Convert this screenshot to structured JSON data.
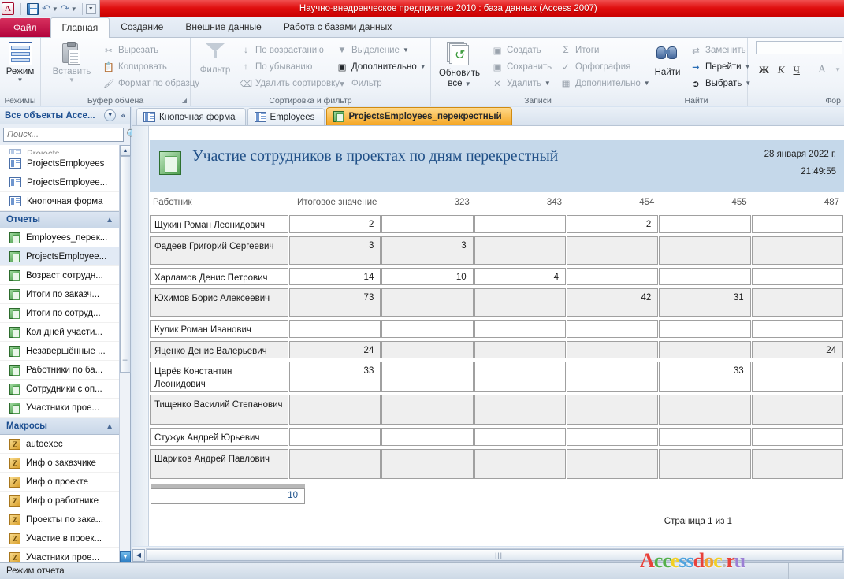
{
  "window": {
    "title": "Научно-внедренческое предприятие 2010 : база данных (Access 2007)",
    "logo_letter": "A",
    "accent_red": "#c80000",
    "accent_orange": "#f5a623",
    "accent_blue": "#1f4f87"
  },
  "ribbon": {
    "file_tab": "Файл",
    "tabs": [
      {
        "label": "Главная",
        "active": true
      },
      {
        "label": "Создание",
        "active": false
      },
      {
        "label": "Внешние данные",
        "active": false
      },
      {
        "label": "Работа с базами данных",
        "active": false
      }
    ],
    "groups": [
      {
        "name": "Режимы",
        "big_button": {
          "label": "Режим",
          "icon": "views-icon"
        },
        "items": []
      },
      {
        "name": "Буфер обмена",
        "big_button": {
          "label": "Вставить",
          "icon": "paste-icon"
        },
        "items": [
          {
            "label": "Вырезать",
            "icon": "scissors-icon"
          },
          {
            "label": "Копировать",
            "icon": "copy-icon"
          },
          {
            "label": "Формат по образцу",
            "icon": "format-painter-icon"
          }
        ]
      },
      {
        "name": "Сортировка и фильтр",
        "big_button": {
          "label": "Фильтр",
          "icon": "funnel-icon"
        },
        "items": [
          {
            "label": "По возрастанию",
            "icon": "sort-asc-icon"
          },
          {
            "label": "По убыванию",
            "icon": "sort-desc-icon"
          },
          {
            "label": "Удалить сортировку",
            "icon": "clear-sort-icon"
          },
          {
            "label": "Выделение",
            "icon": "selection-icon"
          },
          {
            "label": "Дополнительно",
            "icon": "advanced-filter-icon"
          },
          {
            "label": "Фильтр",
            "icon": "filter-icon"
          }
        ]
      },
      {
        "name": "Записи",
        "big_button": {
          "label_line1": "Обновить",
          "label_line2": "все",
          "icon": "refresh-all-icon"
        },
        "items": [
          {
            "label": "Создать",
            "icon": "new-record-icon"
          },
          {
            "label": "Сохранить",
            "icon": "save-record-icon"
          },
          {
            "label": "Удалить",
            "icon": "delete-record-icon"
          },
          {
            "label": "Итоги",
            "icon": "sum-icon"
          },
          {
            "label": "Орфография",
            "icon": "spelling-icon"
          },
          {
            "label": "Дополнительно",
            "icon": "more-records-icon"
          }
        ]
      },
      {
        "name": "Найти",
        "big_button": {
          "label": "Найти",
          "icon": "binoculars-icon"
        },
        "items": [
          {
            "label": "Заменить",
            "icon": "replace-icon"
          },
          {
            "label": "Перейти",
            "icon": "goto-icon"
          },
          {
            "label": "Выбрать",
            "icon": "select-icon"
          }
        ]
      },
      {
        "name": "Фор",
        "format": {
          "bold": "Ж",
          "italic": "К",
          "underline": "Ч",
          "font_color": "A"
        }
      }
    ]
  },
  "navpane": {
    "title": "Все объекты Acce...",
    "search_placeholder": "Поиск...",
    "groups": [
      {
        "label": "",
        "items": [
          {
            "label": "ProjectsEmployees",
            "icon": "form-icon",
            "selected": false
          },
          {
            "label": "ProjectsEmployee...",
            "icon": "form-icon",
            "selected": false
          },
          {
            "label": "Кнопочная форма",
            "icon": "form-icon",
            "selected": false
          }
        ]
      },
      {
        "label": "Отчеты",
        "items": [
          {
            "label": "Employees_перек...",
            "icon": "report-icon",
            "selected": false
          },
          {
            "label": "ProjectsEmployee...",
            "icon": "report-icon",
            "selected": true
          },
          {
            "label": "Возраст сотрудн...",
            "icon": "report-icon",
            "selected": false
          },
          {
            "label": "Итоги по заказч...",
            "icon": "report-icon",
            "selected": false
          },
          {
            "label": "Итоги по сотруд...",
            "icon": "report-icon",
            "selected": false
          },
          {
            "label": "Кол дней участи...",
            "icon": "report-icon",
            "selected": false
          },
          {
            "label": "Незавершённые ...",
            "icon": "report-icon",
            "selected": false
          },
          {
            "label": "Работники по ба...",
            "icon": "report-icon",
            "selected": false
          },
          {
            "label": "Сотрудники с оп...",
            "icon": "report-icon",
            "selected": false
          },
          {
            "label": "Участники прое...",
            "icon": "report-icon",
            "selected": false
          }
        ]
      },
      {
        "label": "Макросы",
        "items": [
          {
            "label": "autoexec",
            "icon": "macro-icon",
            "selected": false
          },
          {
            "label": "Инф о заказчике",
            "icon": "macro-icon",
            "selected": false
          },
          {
            "label": "Инф о проекте",
            "icon": "macro-icon",
            "selected": false
          },
          {
            "label": "Инф о работнике",
            "icon": "macro-icon",
            "selected": false
          },
          {
            "label": "Проекты по зака...",
            "icon": "macro-icon",
            "selected": false
          },
          {
            "label": "Участие в проек...",
            "icon": "macro-icon",
            "selected": false
          },
          {
            "label": "Участники прое...",
            "icon": "macro-icon",
            "selected": false
          }
        ]
      }
    ]
  },
  "doctabs": [
    {
      "label": "Кнопочная форма",
      "icon": "form-icon",
      "active": false
    },
    {
      "label": "Employees",
      "icon": "form-icon",
      "active": false
    },
    {
      "label": "ProjectsEmployees_перекрестный",
      "icon": "report-icon",
      "active": true
    }
  ],
  "report": {
    "title": "Участие сотрудников в проектах по дням перекрестный",
    "date": "28 января 2022 г.",
    "time": "21:49:55",
    "page_label": "Страница 1 из 1",
    "grand_total": "10",
    "headers": [
      "Работник",
      "Итоговое значение",
      "323",
      "343",
      "454",
      "455",
      "487"
    ],
    "rows": [
      {
        "name": "Щукин Роман Леонидович",
        "values": [
          "2",
          "",
          "",
          "2",
          "",
          ""
        ]
      },
      {
        "name": "Фадеев Григорий Сергеевич",
        "values": [
          "3",
          "3",
          "",
          "",
          "",
          ""
        ]
      },
      {
        "name": "Харламов Денис Петрович",
        "values": [
          "14",
          "10",
          "4",
          "",
          "",
          ""
        ]
      },
      {
        "name": "Юхимов Борис Алексеевич",
        "values": [
          "73",
          "",
          "",
          "42",
          "31",
          ""
        ]
      },
      {
        "name": "Кулик Роман Иванович",
        "values": [
          "",
          "",
          "",
          "",
          "",
          ""
        ]
      },
      {
        "name": "Яценко Денис Валерьевич",
        "values": [
          "24",
          "",
          "",
          "",
          "",
          "24"
        ]
      },
      {
        "name": "Царёв Константин Леонидович",
        "values": [
          "33",
          "",
          "",
          "",
          "33",
          ""
        ]
      },
      {
        "name": "Тищенко Василий Степанович",
        "values": [
          "",
          "",
          "",
          "",
          "",
          ""
        ]
      },
      {
        "name": "Стужук Андрей Юрьевич",
        "values": [
          "",
          "",
          "",
          "",
          "",
          ""
        ]
      },
      {
        "name": "Шариков Андрей Павлович",
        "values": [
          "",
          "",
          "",
          "",
          "",
          ""
        ]
      }
    ]
  },
  "statusbar": {
    "mode": "Режим отчета"
  },
  "watermark": {
    "letters": [
      {
        "ch": "A",
        "color": "#e8413a"
      },
      {
        "ch": "c",
        "color": "#54b04a"
      },
      {
        "ch": "c",
        "color": "#54b04a"
      },
      {
        "ch": "e",
        "color": "#f2d024"
      },
      {
        "ch": "s",
        "color": "#4fa3dd"
      },
      {
        "ch": "s",
        "color": "#4fa3dd"
      },
      {
        "ch": "d",
        "color": "#e8413a"
      },
      {
        "ch": "o",
        "color": "#f0a22e"
      },
      {
        "ch": "c",
        "color": "#f2d024"
      },
      {
        "ch": ".",
        "color": "#bbbbbb"
      },
      {
        "ch": "r",
        "color": "#e8413a"
      },
      {
        "ch": "u",
        "color": "#9b7fd4"
      }
    ]
  }
}
